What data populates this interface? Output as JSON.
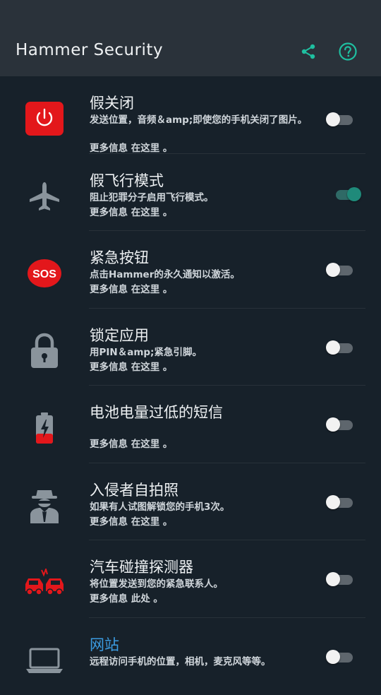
{
  "app": {
    "title": "Hammer Security",
    "accent_color": "#1fbfa0",
    "icons": [
      "share-icon",
      "help-icon"
    ]
  },
  "features": [
    {
      "title": "假关闭",
      "desc": "发送位置，音频＆amp;即使您的手机关闭了图片。",
      "more": "更多信息 在这里 。",
      "icon": "power-icon",
      "enabled": false
    },
    {
      "title": "假飞行模式",
      "desc": "阻止犯罪分子启用飞行模式。",
      "more": "更多信息 在这里 。",
      "icon": "airplane-icon",
      "enabled": true
    },
    {
      "title": "紧急按钮",
      "desc": "点击Hammer的永久通知以激活。",
      "more": "更多信息 在这里 。",
      "icon": "sos-icon",
      "icon_text": "SOS",
      "enabled": false
    },
    {
      "title": "锁定应用",
      "desc": "用PIN＆amp;紧急引脚。",
      "more": "更多信息 在这里 。",
      "icon": "lock-icon",
      "enabled": false
    },
    {
      "title": "电池电量过低的短信",
      "desc": "",
      "more": "更多信息 在这里 。",
      "icon": "battery-low-icon",
      "enabled": false
    },
    {
      "title": "入侵者自拍照",
      "desc": "如果有人试图解锁您的手机3次。",
      "more": "更多信息 在这里 。",
      "icon": "intruder-icon",
      "enabled": false
    },
    {
      "title": "汽车碰撞探测器",
      "desc": "将位置发送到您的紧急联系人。",
      "more": "更多信息 此处 。",
      "icon": "car-crash-icon",
      "enabled": false
    },
    {
      "title": "网站",
      "desc": "远程访问手机的位置，相机，麦克风等等。",
      "more": "",
      "icon": "laptop-icon",
      "enabled": false
    }
  ]
}
